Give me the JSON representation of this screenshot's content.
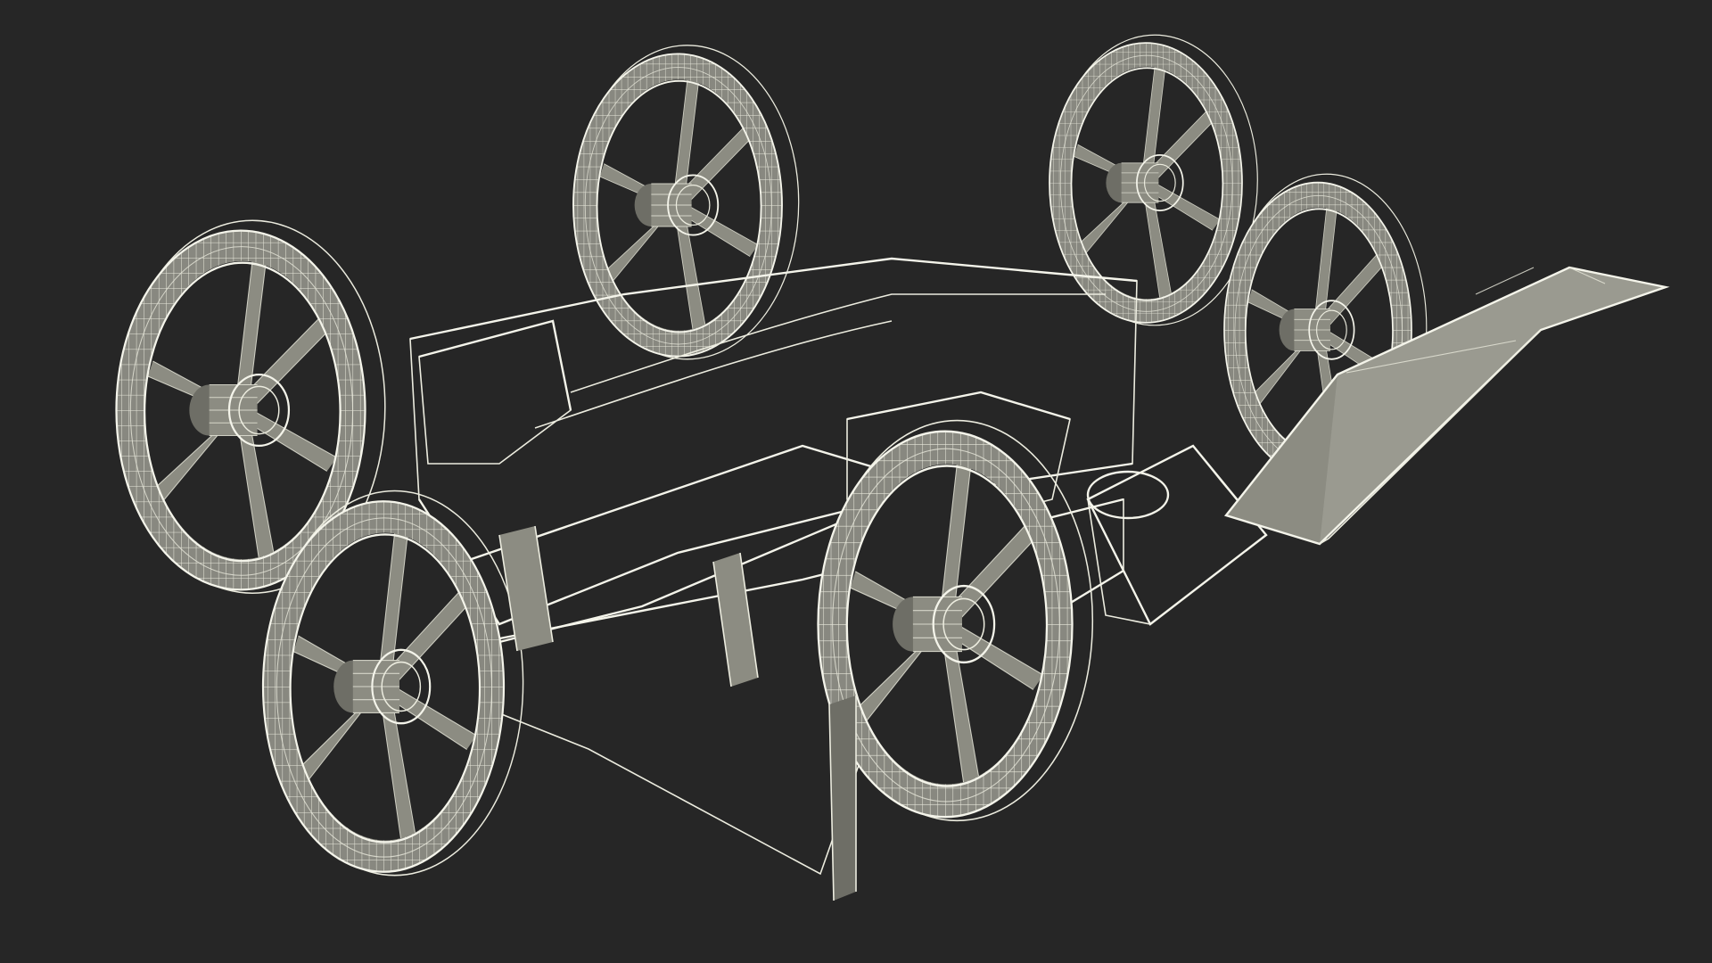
{
  "viewport": {
    "background": "#262626"
  },
  "model": {
    "wire_color": "#ececdf",
    "surface_color": "#8c8c82"
  }
}
